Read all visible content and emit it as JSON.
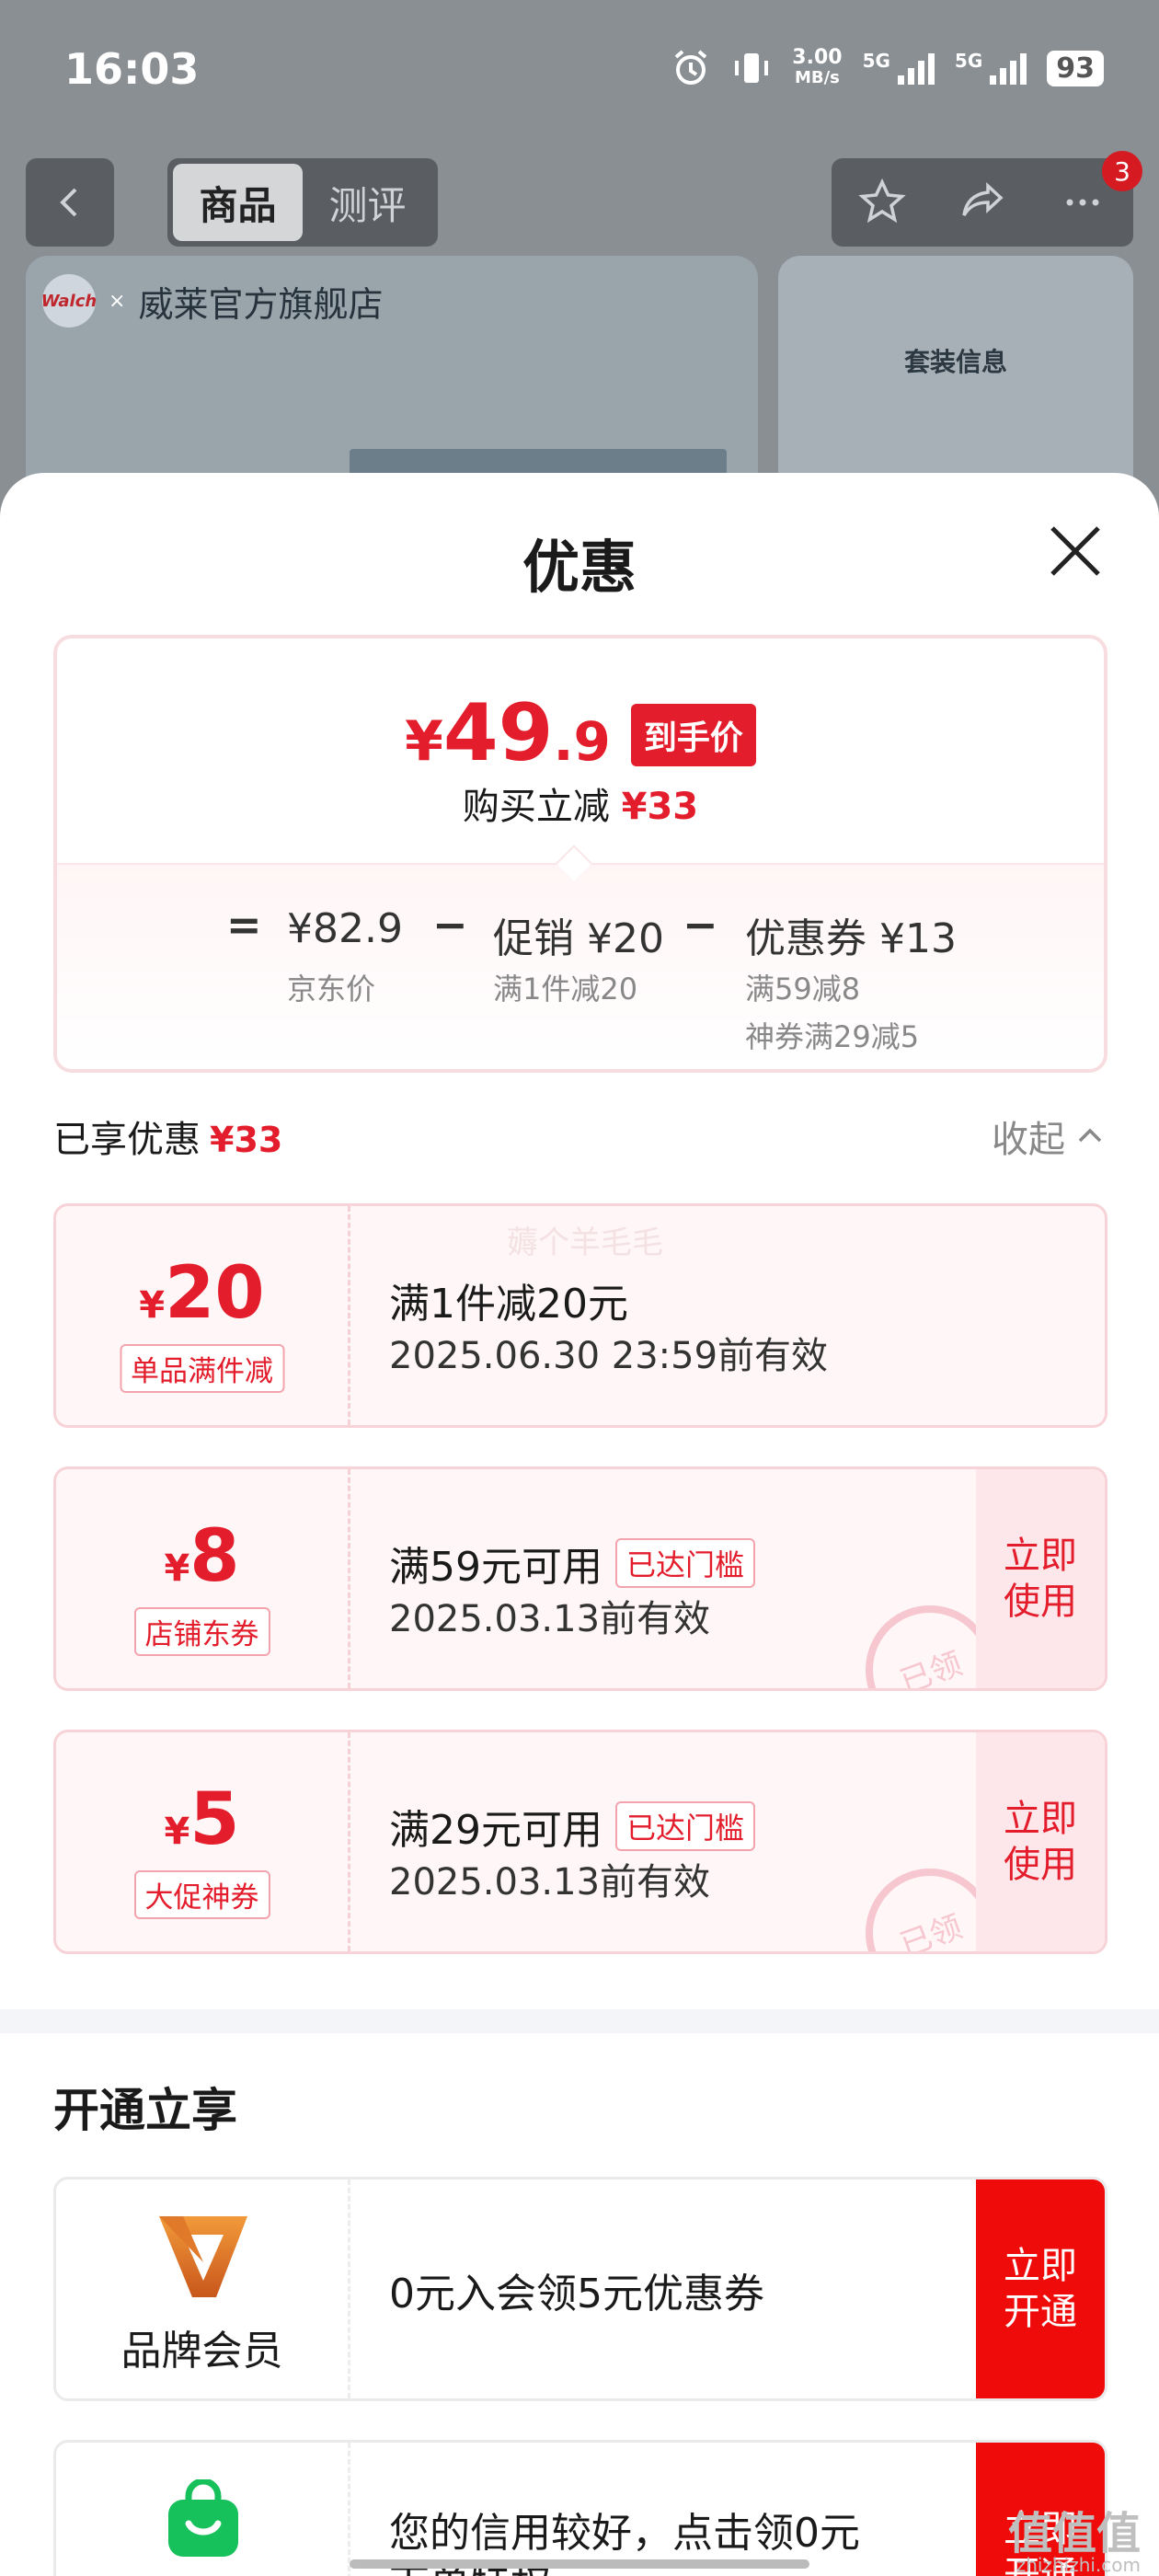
{
  "status_bar": {
    "time": "16:03",
    "speed_value": "3.00",
    "speed_unit": "MB/s",
    "network1": "5G",
    "network2": "5G",
    "battery": "93"
  },
  "header": {
    "tabs": [
      {
        "label": "商品"
      },
      {
        "label": "测评"
      }
    ],
    "more_badge": "3"
  },
  "background": {
    "store_logo_text": "Walch",
    "store_name": "威莱官方旗舰店",
    "panel_title": "套装信息"
  },
  "sheet": {
    "title": "优惠",
    "summary": {
      "price_symbol": "¥",
      "price_int": "49",
      "price_dec": ".9",
      "price_tag": "到手价",
      "save_label": "购买立减",
      "save_amount": "¥33",
      "equals": "=",
      "jd_price": "¥82.9",
      "jd_price_label": "京东价",
      "minus1": "−",
      "promo": "促销 ¥20",
      "promo_detail": "满1件减20",
      "minus2": "−",
      "coupon": "优惠券 ¥13",
      "coupon_detail1": "满59减8",
      "coupon_detail2": "神券满29减5"
    },
    "enjoyed": {
      "label": "已享优惠",
      "amount": "¥33",
      "collapse": "收起"
    },
    "watermark": "薅个羊毛毛",
    "coupons": [
      {
        "symbol": "¥",
        "value": "20",
        "tag": "单品满件减",
        "condition": "满1件减20元",
        "valid": "2025.06.30 23:59前有效"
      },
      {
        "symbol": "¥",
        "value": "8",
        "tag": "店铺东券",
        "condition": "满59元可用",
        "reached": "已达门槛",
        "valid": "2025.03.13前有效",
        "action": "立即使用",
        "stamp": "已领"
      },
      {
        "symbol": "¥",
        "value": "5",
        "tag": "大促神券",
        "condition": "满29元可用",
        "reached": "已达门槛",
        "valid": "2025.03.13前有效",
        "action": "立即使用",
        "stamp": "已领"
      }
    ],
    "open_section": {
      "title": "开通立享",
      "items": [
        {
          "name": "品牌会员",
          "desc": "0元入会领5元优惠券",
          "action": "立即开通"
        },
        {
          "desc": "您的信用较好，点击领0元",
          "desc2": "下单特权",
          "action": "立即开通"
        }
      ]
    }
  },
  "site_mark": {
    "main": "值值值",
    "sub": "zhizhizhi.com"
  },
  "colors": {
    "accent": "#e31d2b",
    "cta": "#f00b0b",
    "coupon_bg": "#fff6f7"
  }
}
